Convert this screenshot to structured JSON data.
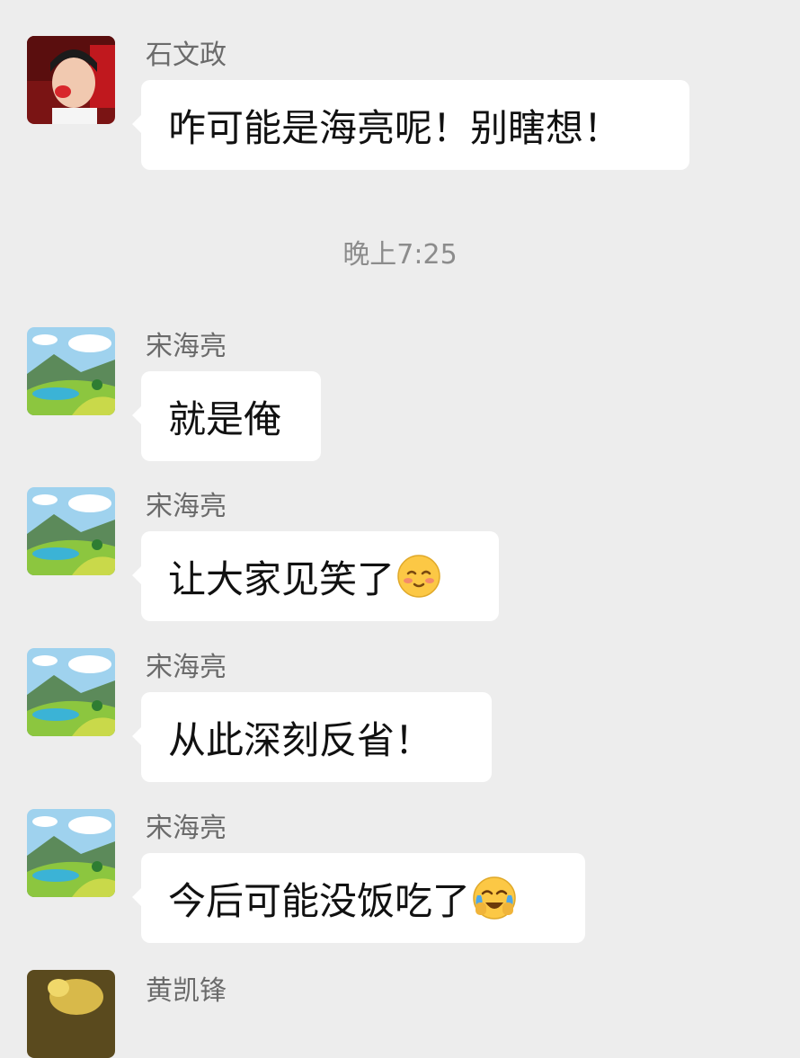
{
  "messages": [
    {
      "sender": "石文政",
      "text": "咋可能是海亮呢！别瞎想！",
      "avatar": "child-photo",
      "emoji": null
    },
    {
      "sender": "宋海亮",
      "text": "就是俺",
      "avatar": "landscape-cartoon",
      "emoji": null
    },
    {
      "sender": "宋海亮",
      "text": "让大家见笑了",
      "avatar": "landscape-cartoon",
      "emoji": "shy-smile-emoji"
    },
    {
      "sender": "宋海亮",
      "text": "从此深刻反省！",
      "avatar": "landscape-cartoon",
      "emoji": null
    },
    {
      "sender": "宋海亮",
      "text": "今后可能没饭吃了",
      "avatar": "landscape-cartoon",
      "emoji": "crying-laughing-emoji"
    }
  ],
  "timestamp": "晚上7:25",
  "partial_message": {
    "sender": "黄凯锋",
    "avatar": "yellow-photo"
  },
  "colors": {
    "background": "#ededed",
    "bubble": "#ffffff",
    "sender_text": "#6b6b6b",
    "timestamp_text": "#8c8c8c"
  }
}
